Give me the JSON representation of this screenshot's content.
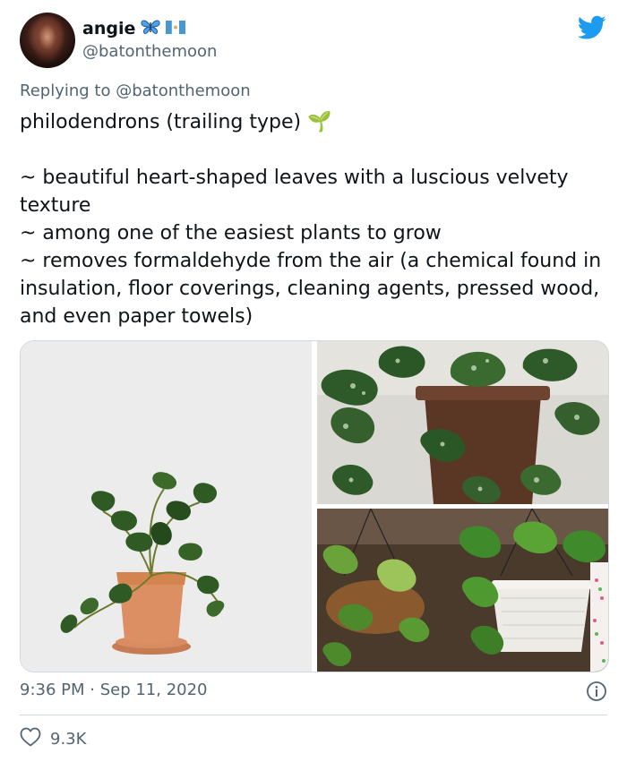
{
  "author": {
    "display_name": "angie",
    "handle": "@batonthemoon",
    "name_emoji": [
      "butterfly-icon",
      "guatemala-flag-icon"
    ]
  },
  "reply": {
    "prefix": "Replying to ",
    "mention": "@batonthemoon"
  },
  "tweet": {
    "text": "philodendrons (trailing type) 🌱\n\n~ beautiful heart-shaped leaves with a luscious velvety texture\n~ among one of the easiest plants to grow\n~ removes formaldehyde from the air (a chemical found in insulation, floor coverings, cleaning agents, pressed wood, and even paper towels)"
  },
  "media": {
    "count": 3,
    "images": [
      "potted-philodendron-photo",
      "variegated-pothos-photo",
      "hanging-pothos-baskets-photo"
    ]
  },
  "meta": {
    "timestamp": "9:36 PM · Sep 11, 2020"
  },
  "engagement": {
    "likes": "9.3K"
  },
  "colors": {
    "brand": "#1d9bf0",
    "secondary_text": "#536471",
    "border": "#cfd9de"
  }
}
